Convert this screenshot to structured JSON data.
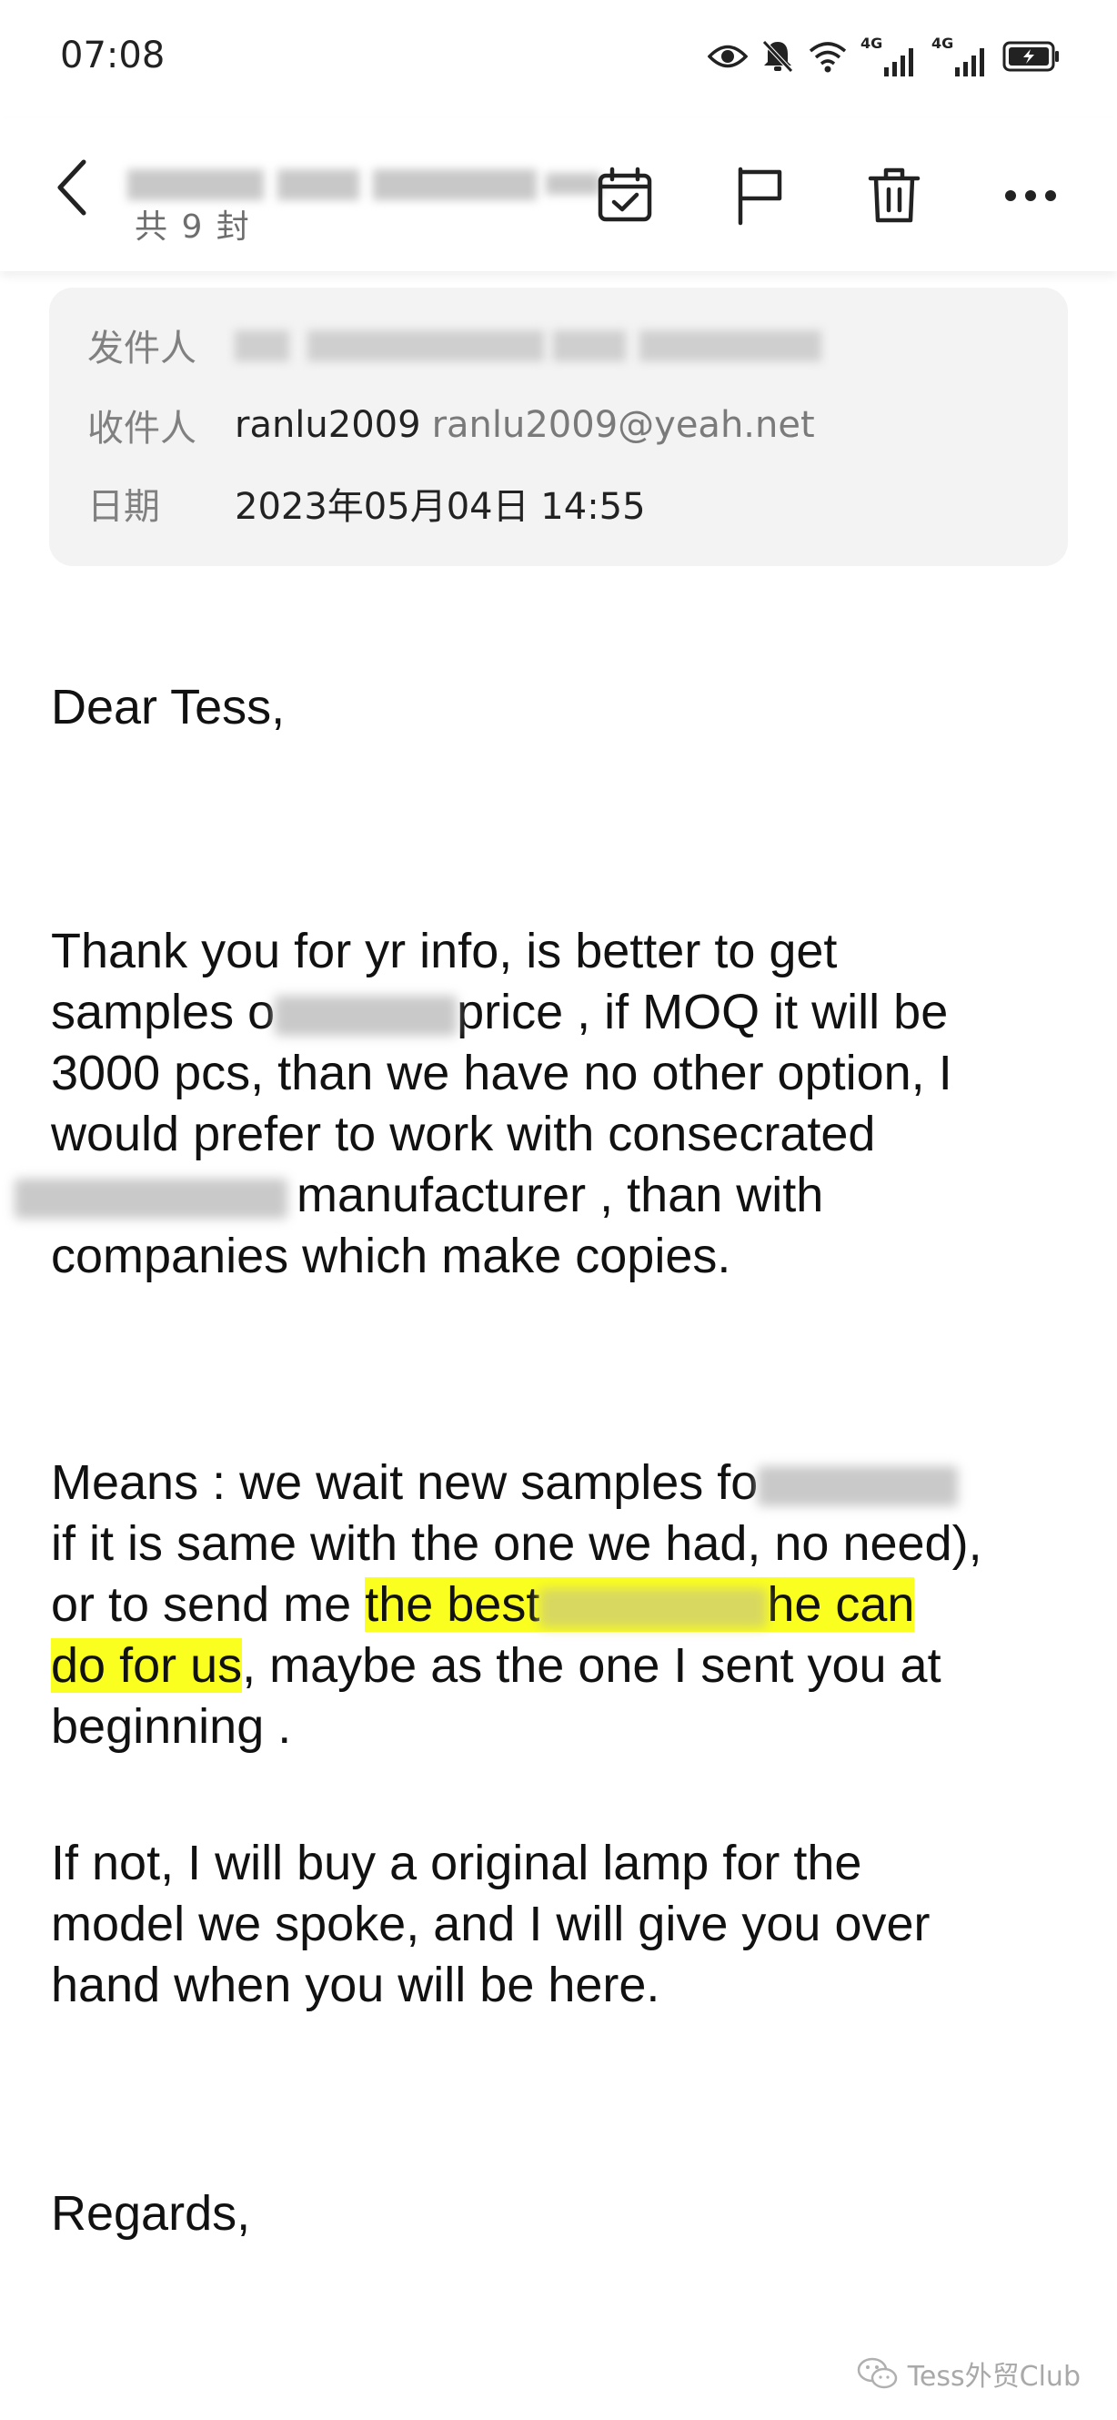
{
  "status_bar": {
    "time": "07:08",
    "network_1": "4G",
    "network_2": "4G",
    "icons": [
      "eye-icon",
      "bell-muted-icon",
      "wifi-icon",
      "signal-icon",
      "signal-icon",
      "battery-charging-icon"
    ]
  },
  "toolbar": {
    "mail_count": "共 9 封",
    "actions": [
      "back-icon",
      "calendar-check-icon",
      "flag-icon",
      "trash-icon",
      "more-icon"
    ]
  },
  "header": {
    "from_label": "发件人",
    "to_label": "收件人",
    "to_name": "ranlu2009",
    "to_address": "ranlu2009@yeah.net",
    "date_label": "日期",
    "date_value": "2023年05月04日 14:55"
  },
  "body": {
    "greeting": "Dear Tess,",
    "p1_l1": "Thank you for yr info, is better to get",
    "p1_l2a": "samples o",
    "p1_l2b": "price , if MOQ it will be",
    "p1_l3": "3000 pcs, than we have no other option, I",
    "p1_l4": "would prefer to work with consecrated",
    "p1_l5": "manufacturer , than with",
    "p1_l6": "companies which make copies.",
    "p2_l1a": "Means : we wait new samples fo",
    "p2_l2": "if it is same with the one we had, no need),",
    "p2_l3a": "or to send me ",
    "p2_l3_hl_a": "the best",
    "p2_l3_hl_b": "he can",
    "p2_l4_hl": "do for us",
    "p2_l4b": ", maybe as the one I sent you at",
    "p2_l5": "beginning .",
    "p3_l1": "If not, I will buy a original lamp for the",
    "p3_l2": "model we spoke, and I will give you over",
    "p3_l3": "hand when you will be here.",
    "closing": "Regards,"
  },
  "watermark": {
    "text": "Tess外贸Club"
  }
}
